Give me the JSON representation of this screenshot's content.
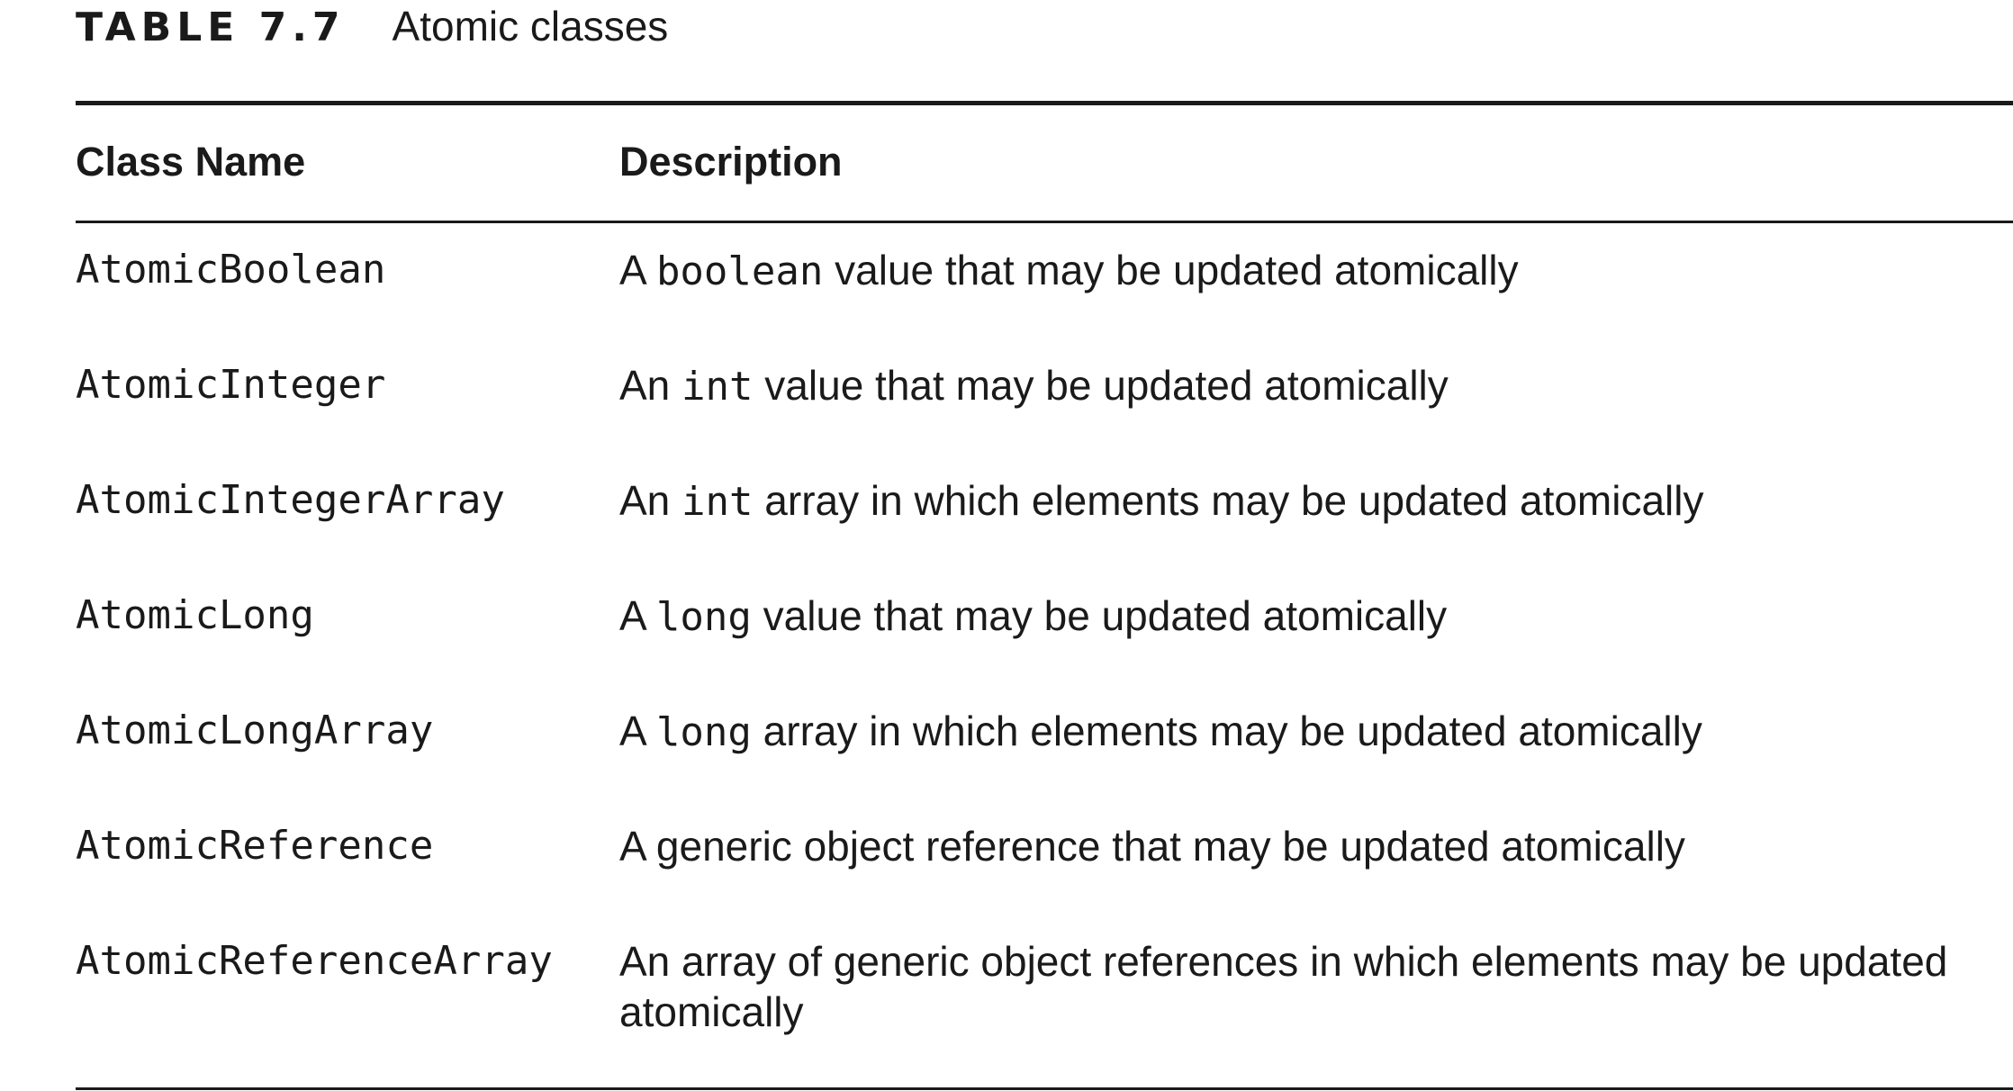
{
  "caption": {
    "label": "TABLE 7.7",
    "title": "Atomic classes"
  },
  "table": {
    "headers": [
      "Class Name",
      "Description"
    ],
    "rows": [
      {
        "name": "AtomicBoolean",
        "desc_pre": "A ",
        "desc_code": "boolean",
        "desc_post": " value that may be updated atomically"
      },
      {
        "name": "AtomicInteger",
        "desc_pre": "An ",
        "desc_code": "int",
        "desc_post": " value that may be updated atomically"
      },
      {
        "name": "AtomicIntegerArray",
        "desc_pre": "An ",
        "desc_code": "int",
        "desc_post": " array in which elements may be updated atomically"
      },
      {
        "name": "AtomicLong",
        "desc_pre": "A ",
        "desc_code": "long",
        "desc_post": " value that may be updated atomically"
      },
      {
        "name": "AtomicLongArray",
        "desc_pre": "A ",
        "desc_code": "long",
        "desc_post": " array in which elements may be updated atomically"
      },
      {
        "name": "AtomicReference",
        "desc_pre": "A generic object reference that may be updated atomically",
        "desc_code": "",
        "desc_post": ""
      },
      {
        "name": "AtomicReferenceArray",
        "desc_pre": "An array of generic object references in which elements may be updated atomically",
        "desc_code": "",
        "desc_post": ""
      }
    ]
  }
}
